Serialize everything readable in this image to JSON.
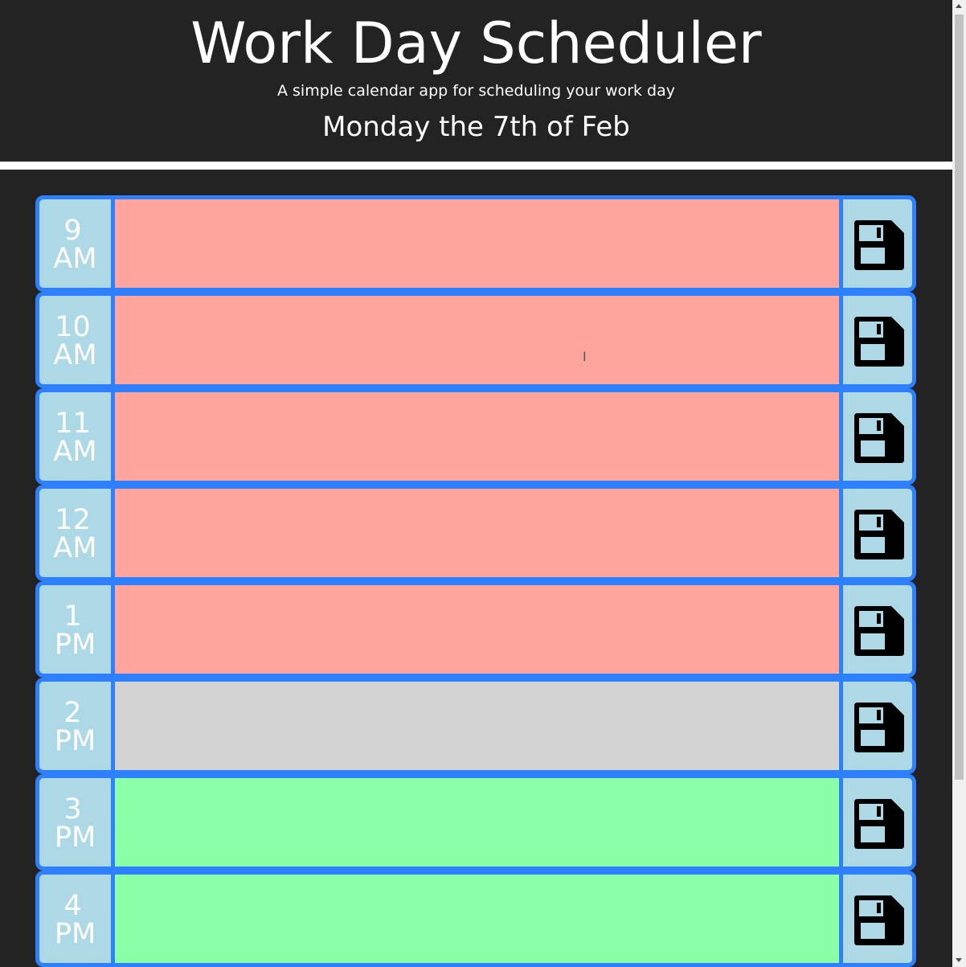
{
  "header": {
    "title": "Work Day Scheduler",
    "subtitle": "A simple calendar app for scheduling your work day",
    "current_date": "Monday the 7th of Feb"
  },
  "colors": {
    "past": "#ffa59e",
    "present": "#d3d3d3",
    "future": "#8affa6",
    "hour_bg": "#add8e6",
    "border": "#2f80ff",
    "page_bg": "#232323"
  },
  "save_icon": "floppy-disk-icon",
  "time_blocks": [
    {
      "hour": "9",
      "period": "AM",
      "state": "past",
      "text": ""
    },
    {
      "hour": "10",
      "period": "AM",
      "state": "past",
      "text": ""
    },
    {
      "hour": "11",
      "period": "AM",
      "state": "past",
      "text": ""
    },
    {
      "hour": "12",
      "period": "AM",
      "state": "past",
      "text": ""
    },
    {
      "hour": "1",
      "period": "PM",
      "state": "past",
      "text": ""
    },
    {
      "hour": "2",
      "period": "PM",
      "state": "present",
      "text": ""
    },
    {
      "hour": "3",
      "period": "PM",
      "state": "future",
      "text": ""
    },
    {
      "hour": "4",
      "period": "PM",
      "state": "future",
      "text": ""
    }
  ]
}
